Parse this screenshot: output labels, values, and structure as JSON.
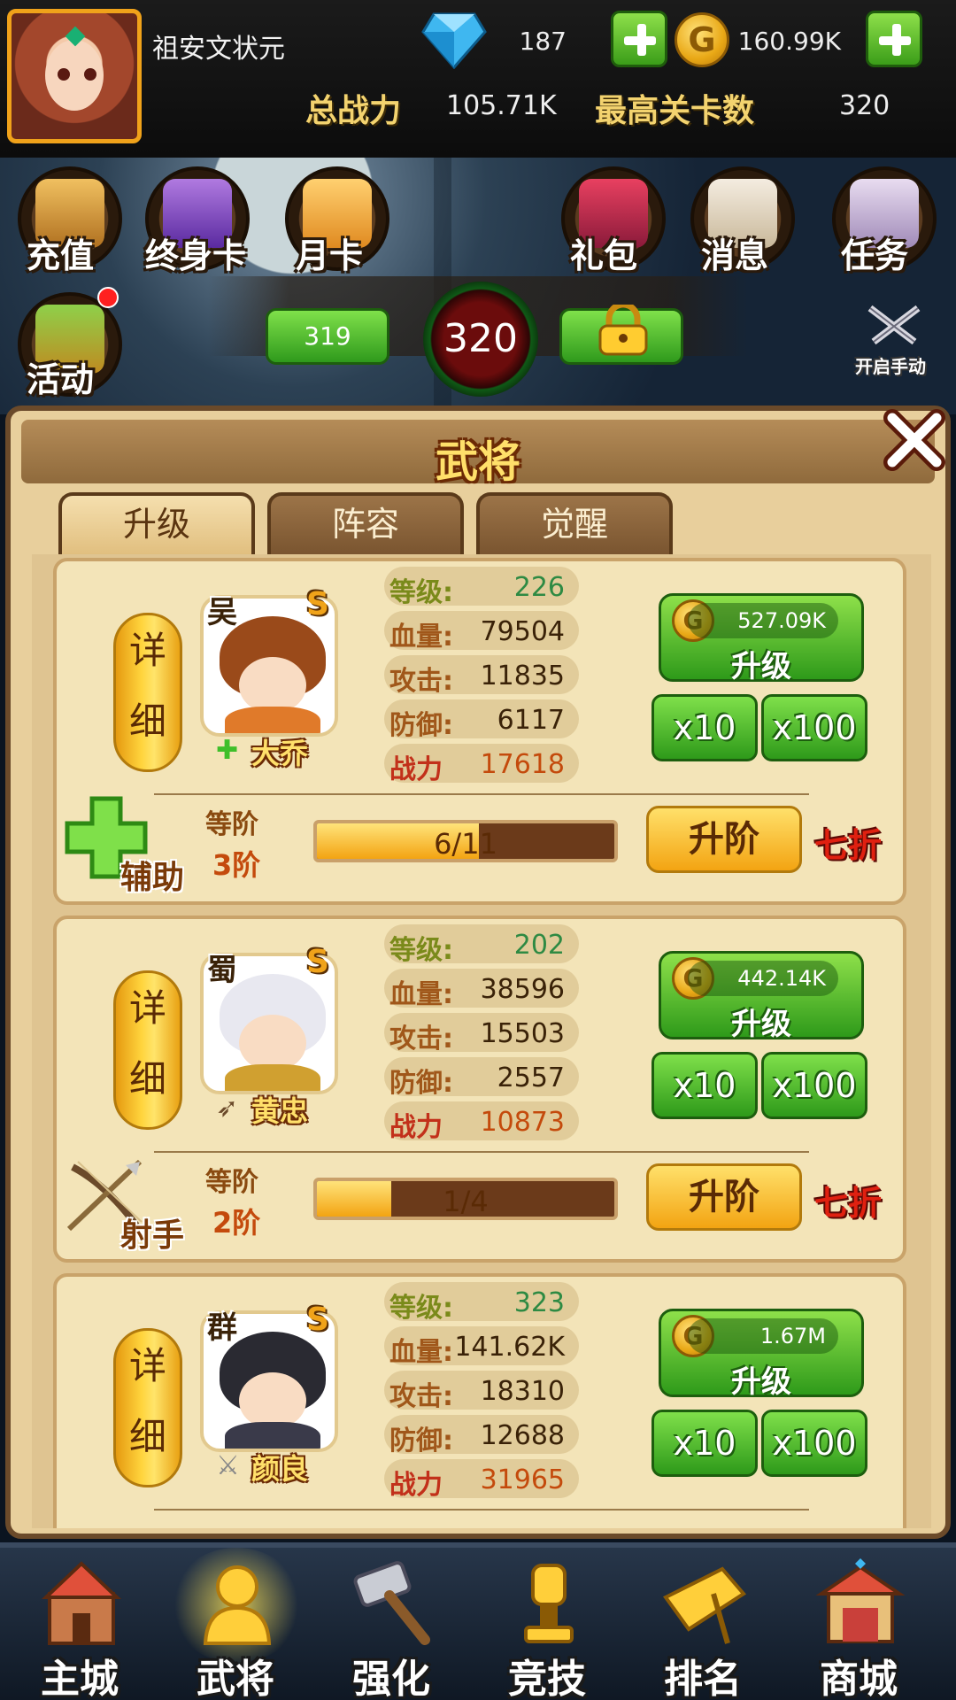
{
  "header": {
    "player_name": "祖安文状元",
    "gems": "187",
    "gold": "160.99K",
    "total_power_label": "总战力",
    "total_power": "105.71K",
    "max_stage_label": "最高关卡数",
    "max_stage": "320"
  },
  "menu": {
    "recharge": "充值",
    "lifetime_card": "终身卡",
    "monthly_card": "月卡",
    "gift_pack": "礼包",
    "messages": "消息",
    "tasks": "任务",
    "events": "活动"
  },
  "stage": {
    "previous": "319",
    "current": "320",
    "manual_label": "开启手动"
  },
  "panel": {
    "title": "武将",
    "tabs": [
      "升级",
      "阵容",
      "觉醒"
    ]
  },
  "labels": {
    "detail_1": "详",
    "detail_2": "细",
    "level": "等级:",
    "hp": "血量:",
    "attack": "攻击:",
    "defense": "防御:",
    "power": "战力",
    "upgrade": "升级",
    "x10": "x10",
    "x100": "x100",
    "rank": "等阶",
    "ascend": "升阶",
    "discount": "七折"
  },
  "heroes": [
    {
      "name": "大乔",
      "faction": "吴",
      "grade": "S",
      "level": "226",
      "hp": "79504",
      "attack": "11835",
      "defense": "6117",
      "power": "17618",
      "upgrade_cost": "527.09K",
      "role": "辅助",
      "rank": "3阶",
      "rank_progress": "6/11",
      "rank_fraction": 0.545
    },
    {
      "name": "黄忠",
      "faction": "蜀",
      "grade": "S",
      "level": "202",
      "hp": "38596",
      "attack": "15503",
      "defense": "2557",
      "power": "10873",
      "upgrade_cost": "442.14K",
      "role": "射手",
      "rank": "2阶",
      "rank_progress": "1/4",
      "rank_fraction": 0.25
    },
    {
      "name": "颜良",
      "faction": "群",
      "grade": "S",
      "level": "323",
      "hp": "141.62K",
      "attack": "18310",
      "defense": "12688",
      "power": "31965",
      "upgrade_cost": "1.67M"
    }
  ],
  "nav": [
    "主城",
    "武将",
    "强化",
    "竞技",
    "排名",
    "商城"
  ],
  "colors": {
    "accent_gold": "#ffe06a",
    "button_green": "#2e9a1a",
    "panel_bg": "#e8cf9c",
    "discount_red": "#e02010"
  }
}
